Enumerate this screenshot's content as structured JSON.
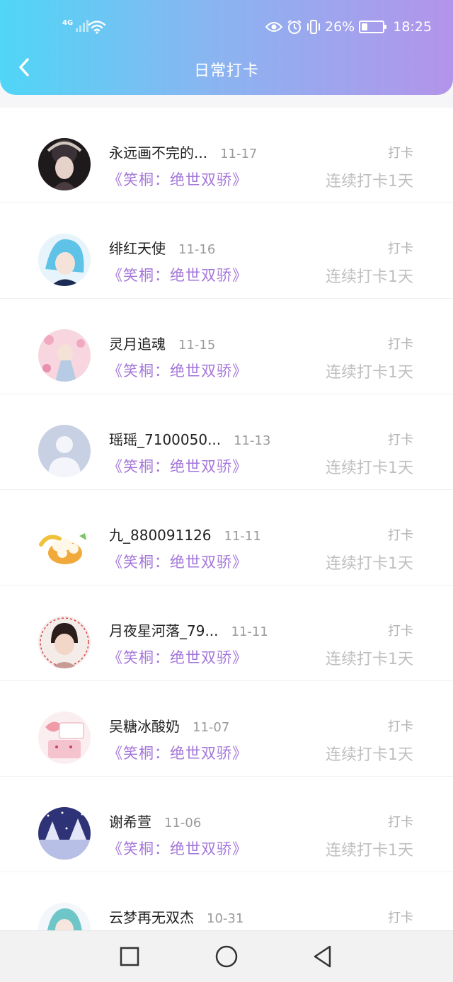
{
  "status": {
    "network": "4G",
    "battery": "26%",
    "battery_level": 0.26,
    "time": "18:25"
  },
  "header": {
    "title": "日常打卡",
    "back_icon": "chevron-left-icon"
  },
  "list": {
    "items": [
      {
        "name": "永远画不完的...",
        "date": "11-17",
        "book": "《笑桐：绝世双骄》",
        "tag": "打卡",
        "streak": "连续打卡1天",
        "avatar": "costume-portrait"
      },
      {
        "name": "绯红天使",
        "date": "11-16",
        "book": "《笑桐：绝世双骄》",
        "tag": "打卡",
        "streak": "连续打卡1天",
        "avatar": "anime-blue-hair"
      },
      {
        "name": "灵月追魂",
        "date": "11-15",
        "book": "《笑桐：绝世双骄》",
        "tag": "打卡",
        "streak": "连续打卡1天",
        "avatar": "anime-pink-blossom"
      },
      {
        "name": "瑶瑶_7100050...",
        "date": "11-13",
        "book": "《笑桐：绝世双骄》",
        "tag": "打卡",
        "streak": "连续打卡1天",
        "avatar": "default-person"
      },
      {
        "name": "九_880091126",
        "date": "11-11",
        "book": "《笑桐：绝世双骄》",
        "tag": "打卡",
        "streak": "连续打卡1天",
        "avatar": "cute-food"
      },
      {
        "name": "月夜星河落_79...",
        "date": "11-11",
        "book": "《笑桐：绝世双骄》",
        "tag": "打卡",
        "streak": "连续打卡1天",
        "avatar": "child-photo"
      },
      {
        "name": "吴糖冰酸奶",
        "date": "11-07",
        "book": "《笑桐：绝世双骄》",
        "tag": "打卡",
        "streak": "连续打卡1天",
        "avatar": "strawberry-sticker"
      },
      {
        "name": "谢希萱",
        "date": "11-06",
        "book": "《笑桐：绝世双骄》",
        "tag": "打卡",
        "streak": "连续打卡1天",
        "avatar": "snow-night"
      },
      {
        "name": "云梦再无双杰",
        "date": "10-31",
        "book": "",
        "tag": "打卡",
        "streak": "",
        "avatar": "anime-teal-hair"
      }
    ]
  },
  "bottom_nav": {
    "buttons": [
      "square-recents-icon",
      "circle-home-icon",
      "triangle-back-icon"
    ]
  }
}
